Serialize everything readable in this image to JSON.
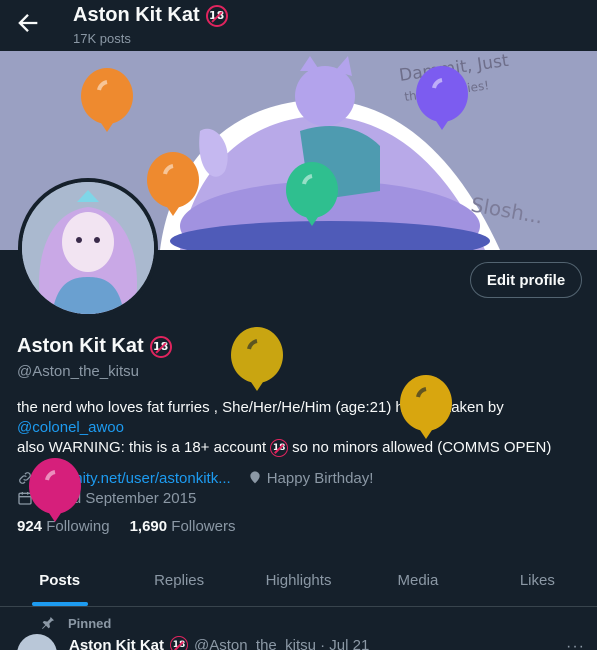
{
  "header": {
    "name": "Aston Kit Kat",
    "post_count": "17K posts",
    "badge": "18"
  },
  "banner": {
    "scribble_1": "Dammit, Just",
    "scribble_2": "these Panties!",
    "scribble_3": "Slosh..."
  },
  "profile": {
    "edit_label": "Edit profile",
    "name": "Aston Kit Kat",
    "badge": "18",
    "handle": "@Aston_the_kitsu",
    "bio": {
      "line1_a": "the nerd who loves fat furries , She/Her/He/Him (age:21)",
      "line1_b": "happily taken by",
      "mention": "@colonel_awoo",
      "line3_a": "also WARNING: this is a 18+ account",
      "line3_b": "so no minors allowed (COMMS OPEN)"
    },
    "link": "furaffinity.net/user/astonkitk...",
    "birthday": "Happy Birthday!",
    "joined": "Joined September 2015",
    "following_count": "924",
    "following_label": "Following",
    "followers_count": "1,690",
    "followers_label": "Followers"
  },
  "tabs": [
    "Posts",
    "Replies",
    "Highlights",
    "Media",
    "Likes"
  ],
  "pinned": {
    "label": "Pinned",
    "author": "Aston Kit Kat",
    "handle_date": "@Aston_the_kitsu · Jul 21",
    "more": "···"
  },
  "balloons": [
    {
      "color": "#ee8a2f"
    },
    {
      "color": "#7c5cf0"
    },
    {
      "color": "#ee8a2f"
    },
    {
      "color": "#2fbf8f"
    },
    {
      "color": "#c9a511"
    },
    {
      "color": "#d8a60f"
    },
    {
      "color": "#d61f7b"
    }
  ],
  "colors": {
    "background": "#15202b",
    "accent": "#1d9bf0",
    "muted": "#8b98a5"
  }
}
